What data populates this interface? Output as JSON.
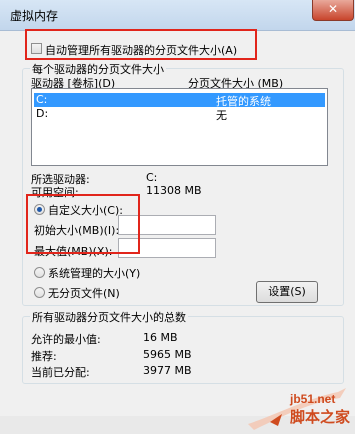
{
  "window": {
    "title": "虚拟内存",
    "close_glyph": "✕"
  },
  "auto_manage": {
    "label": "自动管理所有驱动器的分页文件大小(A)",
    "checked": false
  },
  "drive_group": {
    "legend": "每个驱动器的分页文件大小",
    "col_drive": "驱动器 [卷标](D)",
    "col_size": "分页文件大小 (MB)",
    "rows": [
      {
        "drive": "C:",
        "size": "托管的系统",
        "selected": true
      },
      {
        "drive": "D:",
        "size": "无",
        "selected": false
      }
    ],
    "selected_drive_label": "所选驱动器:",
    "selected_drive_value": "C:",
    "free_space_label": "可用空间:",
    "free_space_value": "11308 MB",
    "custom_size_label": "自定义大小(C):",
    "initial_size_label": "初始大小(MB)(I):",
    "initial_size_value": "",
    "max_size_label": "最大值(MB)(X):",
    "max_size_value": "",
    "system_managed_label": "系统管理的大小(Y)",
    "no_paging_label": "无分页文件(N)",
    "set_button": "设置(S)"
  },
  "total_group": {
    "legend": "所有驱动器分页文件大小的总数",
    "min_label": "允许的最小值:",
    "min_value": "16 MB",
    "recommended_label": "推荐:",
    "recommended_value": "5965 MB",
    "current_label": "当前已分配:",
    "current_value": "3977 MB"
  },
  "watermark": {
    "site": "jb51.net",
    "name": "脚本之家"
  },
  "colors": {
    "highlight": "#3399ff",
    "annotation_red": "#e1251b",
    "watermark": "#cf4b1f"
  }
}
